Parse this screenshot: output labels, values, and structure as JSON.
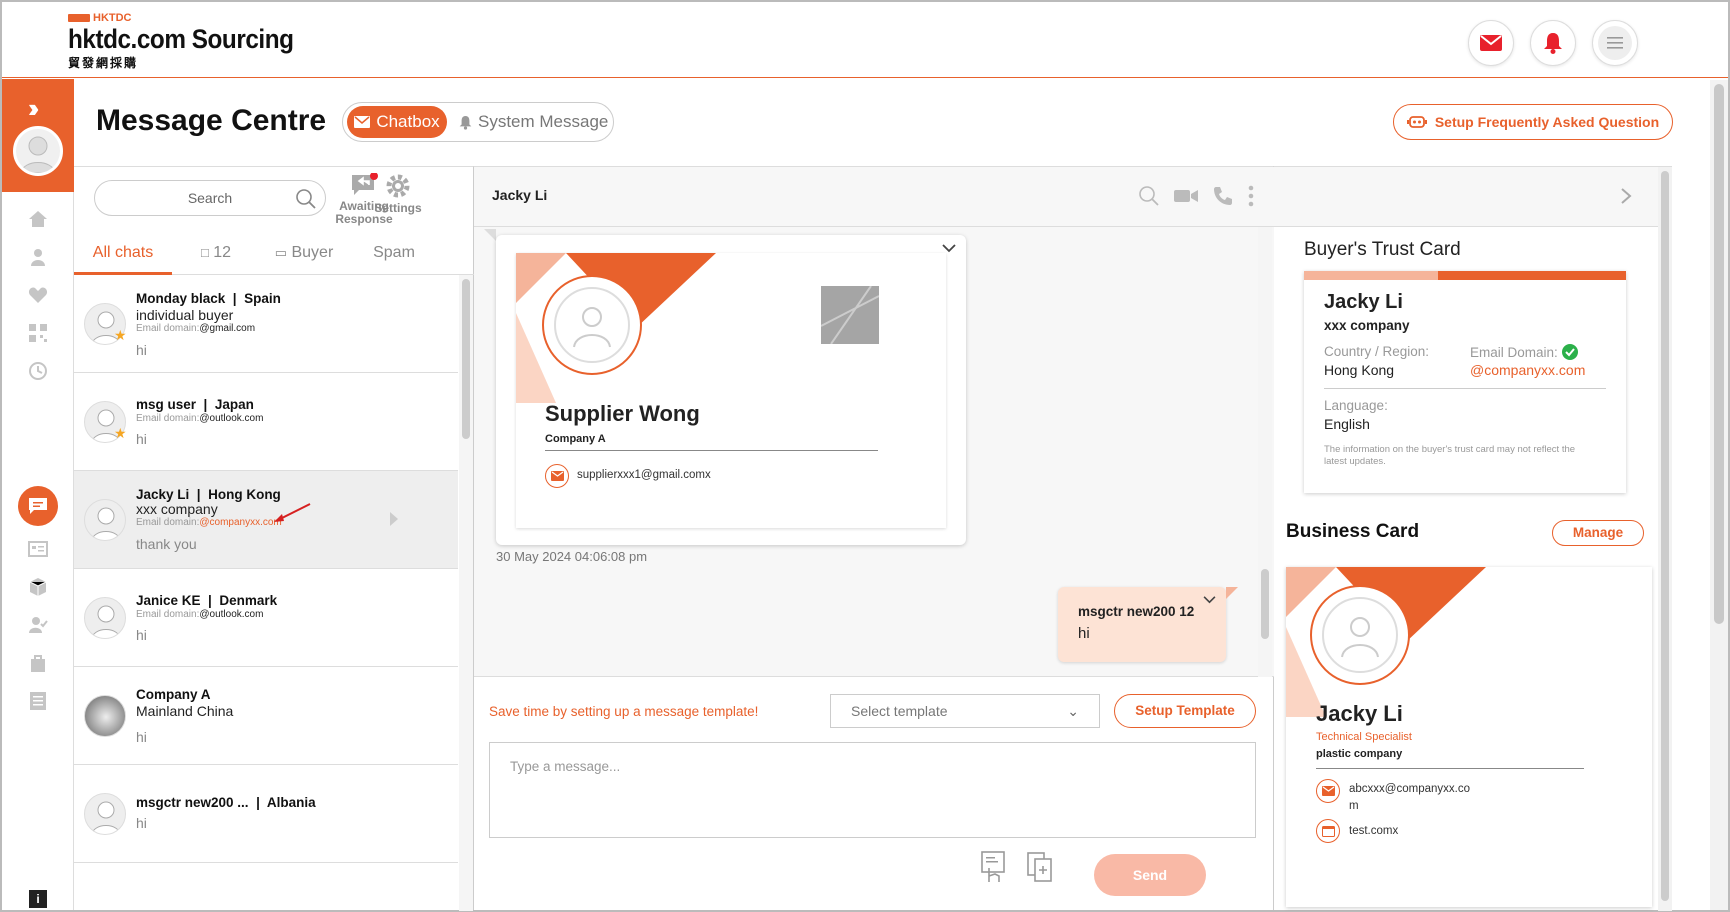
{
  "brand": {
    "tag": "HKTDC",
    "name": "hktdc.com Sourcing",
    "name_cn": "貿發網採購"
  },
  "header_icons": [
    "mail-icon",
    "bell-icon",
    "menu-icon"
  ],
  "page": {
    "title": "Message Centre",
    "tab_chatbox": "Chatbox",
    "tab_system": "System Message",
    "faq_button": "Setup Frequently Asked Question"
  },
  "list": {
    "search_placeholder": "Search",
    "awaiting_line1": "Awaiting",
    "awaiting_line2": "Response",
    "settings": "Settings",
    "tabs": {
      "all": "All chats",
      "count": "12",
      "buyer": "Buyer",
      "spam": "Spam"
    },
    "domain_label": "Email domain:",
    "chats": [
      {
        "name": "Monday black",
        "region": "Spain",
        "line2": "individual buyer",
        "domain": "@gmail.com",
        "msg": "hi"
      },
      {
        "name": "msg user",
        "region": "Japan",
        "domain": "@outlook.com",
        "msg": "hi"
      },
      {
        "name": "Jacky Li",
        "region": "Hong Kong",
        "line2": "xxx company",
        "domain": "@companyxx.com",
        "msg": "thank you"
      },
      {
        "name": "Janice KE",
        "region": "Denmark",
        "domain": "@outlook.com",
        "msg": "hi"
      },
      {
        "name": "Company A",
        "line2": "Mainland China",
        "msg": "hi"
      },
      {
        "name": "msgctr new200 ...",
        "region": "Albania",
        "msg": "hi"
      }
    ]
  },
  "conversation": {
    "contact": "Jacky Li",
    "card": {
      "name": "Supplier Wong",
      "company": "Company A",
      "email": "supplierxxx1@gmail.comx"
    },
    "timestamp": "30 May 2024 04:06:08 pm",
    "outgoing": {
      "sender": "msgctr new200 12",
      "text": "hi"
    },
    "template_hint": "Save time by setting up a message template!",
    "template_select": "Select template",
    "template_button": "Setup Template",
    "input_placeholder": "Type a message...",
    "send": "Send"
  },
  "trust_card": {
    "title": "Buyer's Trust Card",
    "name": "Jacky Li",
    "company": "xxx company",
    "country_label": "Country / Region:",
    "country": "Hong Kong",
    "email_label": "Email Domain:",
    "email": "@companyxx.com",
    "language_label": "Language:",
    "language": "English",
    "note": "The information on the buyer's trust card may not reflect the latest updates."
  },
  "business_card": {
    "title": "Business Card",
    "manage": "Manage",
    "name": "Jacky Li",
    "role": "Technical Specialist",
    "company": "plastic company",
    "email_line1": "abcxxx@companyxx.co",
    "email_line2": "m",
    "website": "test.comx"
  },
  "colors": {
    "accent": "#e8612c",
    "accent_light": "#f5b49a",
    "bubble": "#fde3d5"
  }
}
